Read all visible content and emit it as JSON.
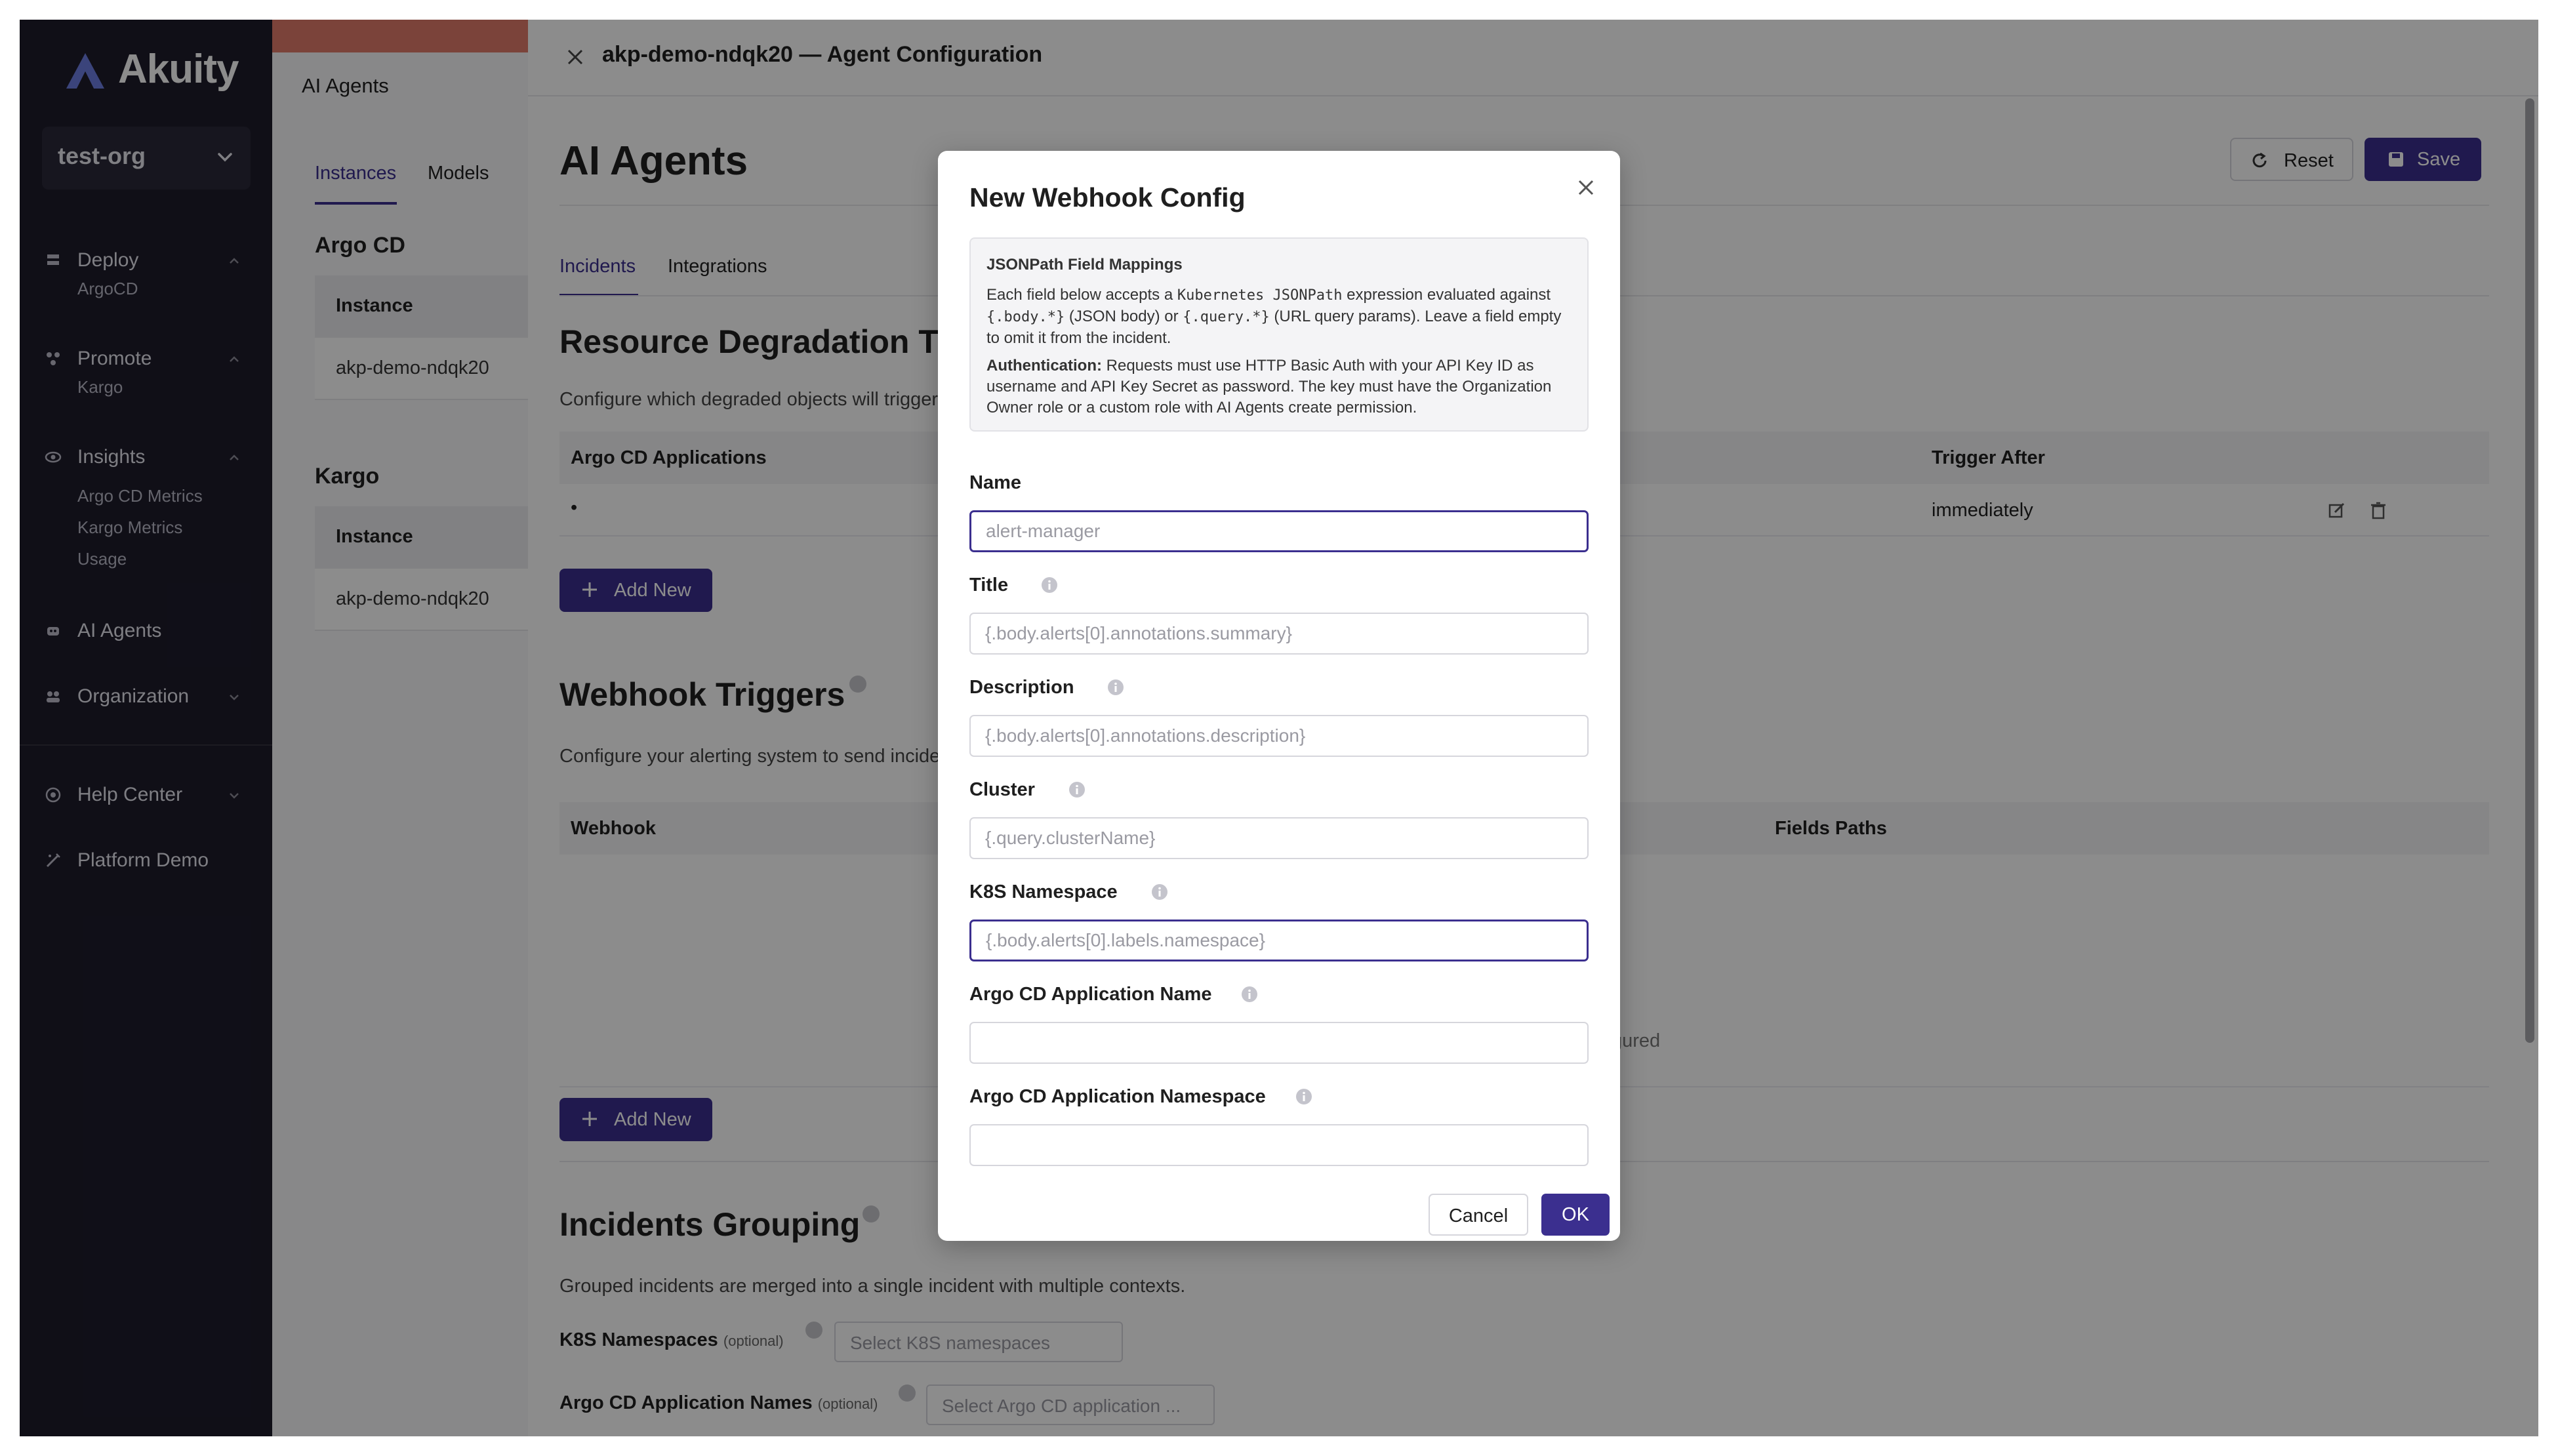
{
  "sidebar": {
    "logo": "Akuity",
    "org": "test-org",
    "items": [
      {
        "label": "Deploy",
        "icon": "deploy-icon"
      },
      {
        "label": "Promote",
        "icon": "promote-icon"
      },
      {
        "label": "Insights",
        "icon": "insights-icon"
      },
      {
        "label": "AI Agents",
        "icon": "ai-agents-icon"
      },
      {
        "label": "Organization",
        "icon": "organization-icon"
      },
      {
        "label": "Help Center",
        "icon": "help-icon"
      },
      {
        "label": "Platform Demo",
        "icon": "platform-demo-icon"
      }
    ],
    "sub": {
      "deploy": [
        "ArgoCD"
      ],
      "promote": [
        "Kargo"
      ],
      "insights": [
        "Argo CD Metrics",
        "Kargo Metrics",
        "Usage"
      ]
    }
  },
  "panel2": {
    "header": "AI Agents",
    "tabs": [
      "Instances",
      "Models"
    ],
    "sections": [
      {
        "title": "Argo CD",
        "col": "Instance",
        "row": "akp-demo-ndqk20"
      },
      {
        "title": "Kargo",
        "col": "Instance",
        "row": "akp-demo-ndqk20"
      }
    ]
  },
  "drawer": {
    "title": "akp-demo-ndqk20 — Agent Configuration",
    "page_title": "AI Agents",
    "reset_label": "Reset",
    "save_label": "Save",
    "tabs": [
      "Incidents",
      "Integrations"
    ],
    "degradation": {
      "title": "Resource Degradation Trig",
      "desc": "Configure which degraded objects will trigger",
      "col1": "Argo CD Applications",
      "col2": "Trigger After",
      "row_bullet": "•",
      "row_trigger": "immediately",
      "add_label": "Add New"
    },
    "webhook": {
      "title": "Webhook Triggers",
      "desc": "Configure your alerting system to send incide",
      "col1": "Webhook",
      "col2": "Fields Paths",
      "empty_fragment": "gured",
      "add_label": "Add New"
    },
    "grouping": {
      "title": "Incidents Grouping",
      "desc": "Grouped incidents are merged into a single incident with multiple contexts.",
      "ns_label": "K8S Namespaces",
      "ns_opt": "(optional)",
      "ns_placeholder": "Select K8S namespaces",
      "app_label": "Argo CD Application Names",
      "app_opt": "(optional)",
      "app_placeholder": "Select Argo CD application ..."
    }
  },
  "modal": {
    "title": "New Webhook Config",
    "info_title": "JSONPath Field Mappings",
    "info_p1_a": "Each field below accepts a ",
    "info_p1_code1": "Kubernetes JSONPath",
    "info_p1_b": " expression evaluated against ",
    "info_p1_code2": "{.body.*}",
    "info_p1_c": " (JSON body) or ",
    "info_p1_code3": "{.query.*}",
    "info_p1_d": " (URL query params). Leave a field empty to omit it from the incident.",
    "info_p2_bold": "Authentication:",
    "info_p2": " Requests must use HTTP Basic Auth with your API Key ID as username and API Key Secret as password. The key must have the Organization Owner role or a custom role with AI Agents create permission.",
    "fields": [
      {
        "label": "Name",
        "placeholder": "alert-manager",
        "value": ""
      },
      {
        "label": "Title",
        "placeholder": "{.body.alerts[0].annotations.summary}",
        "value": ""
      },
      {
        "label": "Description",
        "placeholder": "{.body.alerts[0].annotations.description}",
        "value": ""
      },
      {
        "label": "Cluster",
        "placeholder": "{.query.clusterName}",
        "value": ""
      },
      {
        "label": "K8S Namespace",
        "placeholder": "{.body.alerts[0].labels.namespace}",
        "value": ""
      },
      {
        "label": "Argo CD Application Name",
        "placeholder": "",
        "value": ""
      },
      {
        "label": "Argo CD Application Namespace",
        "placeholder": "",
        "value": ""
      }
    ],
    "cancel_label": "Cancel",
    "ok_label": "OK"
  },
  "colors": {
    "accent": "#3b2f8f",
    "sidebar": "#1e1c2b"
  }
}
